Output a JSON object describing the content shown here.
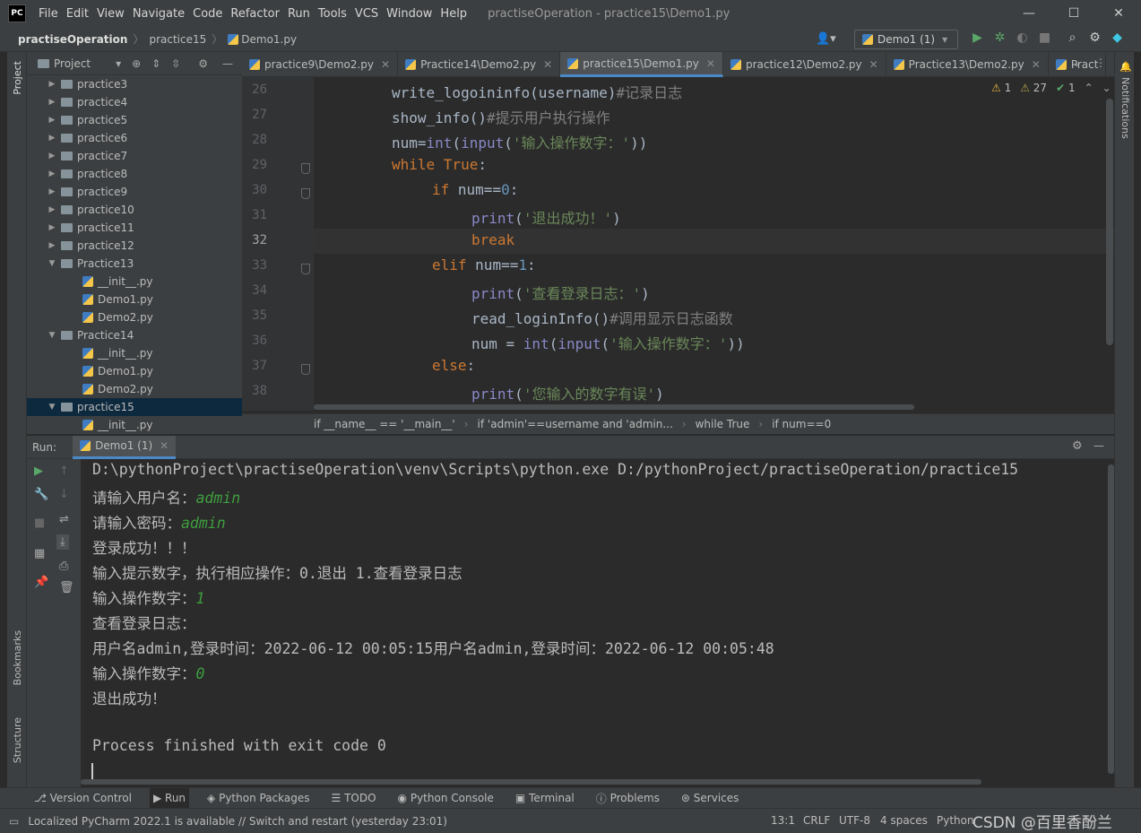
{
  "titlebar": {
    "logo": "PC",
    "menu": [
      "File",
      "Edit",
      "View",
      "Navigate",
      "Code",
      "Refactor",
      "Run",
      "Tools",
      "VCS",
      "Window",
      "Help"
    ],
    "window_title": "practiseOperation - practice15\\Demo1.py",
    "minimize": "—",
    "maximize": "☐",
    "close": "✕"
  },
  "navbar": {
    "project": "practiseOperation",
    "folder": "practice15",
    "file": "Demo1.py",
    "run_config": "Demo1 (1)"
  },
  "project_panel": {
    "title": "Project",
    "items": [
      {
        "label": "practice3",
        "type": "folder",
        "expanded": false,
        "indent": 1
      },
      {
        "label": "practice4",
        "type": "folder",
        "expanded": false,
        "indent": 1
      },
      {
        "label": "practice5",
        "type": "folder",
        "expanded": false,
        "indent": 1
      },
      {
        "label": "practice6",
        "type": "folder",
        "expanded": false,
        "indent": 1
      },
      {
        "label": "practice7",
        "type": "folder",
        "expanded": false,
        "indent": 1
      },
      {
        "label": "practice8",
        "type": "folder",
        "expanded": false,
        "indent": 1
      },
      {
        "label": "practice9",
        "type": "folder",
        "expanded": false,
        "indent": 1
      },
      {
        "label": "practice10",
        "type": "folder",
        "expanded": false,
        "indent": 1
      },
      {
        "label": "practice11",
        "type": "folder",
        "expanded": false,
        "indent": 1
      },
      {
        "label": "practice12",
        "type": "folder",
        "expanded": false,
        "indent": 1
      },
      {
        "label": "Practice13",
        "type": "folder",
        "expanded": true,
        "indent": 1
      },
      {
        "label": "__init__.py",
        "type": "py",
        "indent": 2
      },
      {
        "label": "Demo1.py",
        "type": "py",
        "indent": 2
      },
      {
        "label": "Demo2.py",
        "type": "py",
        "indent": 2
      },
      {
        "label": "Practice14",
        "type": "folder",
        "expanded": true,
        "indent": 1
      },
      {
        "label": "__init__.py",
        "type": "py",
        "indent": 2
      },
      {
        "label": "Demo1.py",
        "type": "py",
        "indent": 2
      },
      {
        "label": "Demo2.py",
        "type": "py",
        "indent": 2
      },
      {
        "label": "practice15",
        "type": "folder",
        "expanded": true,
        "indent": 1,
        "selected": true
      },
      {
        "label": "__init__.py",
        "type": "py",
        "indent": 2
      }
    ]
  },
  "tabs": [
    {
      "label": "practice9\\Demo2.py",
      "active": false
    },
    {
      "label": "Practice14\\Demo2.py",
      "active": false
    },
    {
      "label": "practice15\\Demo1.py",
      "active": true
    },
    {
      "label": "practice12\\Demo2.py",
      "active": false
    },
    {
      "label": "Practice13\\Demo2.py",
      "active": false
    },
    {
      "label": "Pract",
      "active": false
    }
  ],
  "inspections": {
    "warnings": "1",
    "weak_warnings": "27",
    "ok": "1"
  },
  "editor": {
    "line_numbers": [
      "26",
      "27",
      "28",
      "29",
      "30",
      "31",
      "32",
      "33",
      "34",
      "35",
      "36",
      "37",
      "38"
    ],
    "current_line": "32"
  },
  "breadcrumb": [
    "if __name__ == '__main__'",
    "if 'admin'==username and 'admin...",
    "while True",
    "if num==0"
  ],
  "run_panel": {
    "label": "Run:",
    "tab": "Demo1 (1)",
    "lines": [
      {
        "text": "D:\\pythonProject\\practiseOperation\\venv\\Scripts\\python.exe D:/pythonProject/practiseOperation/practice15",
        "input": ""
      },
      {
        "text": "请输入用户名：",
        "input": "admin"
      },
      {
        "text": "请输入密码：",
        "input": "admin"
      },
      {
        "text": "登录成功！！！",
        "input": ""
      },
      {
        "text": "输入提示数字，执行相应操作：0.退出 1.查看登录日志",
        "input": ""
      },
      {
        "text": "输入操作数字：",
        "input": "1"
      },
      {
        "text": "查看登录日志：",
        "input": ""
      },
      {
        "text": "用户名admin,登录时间：2022-06-12 00:05:15用户名admin,登录时间：2022-06-12 00:05:48",
        "input": ""
      },
      {
        "text": "输入操作数字：",
        "input": "0"
      },
      {
        "text": "退出成功！",
        "input": ""
      },
      {
        "text": "",
        "input": ""
      },
      {
        "text": "Process finished with exit code 0",
        "input": ""
      }
    ]
  },
  "bottom_tools": [
    "Version Control",
    "Run",
    "Python Packages",
    "TODO",
    "Python Console",
    "Terminal",
    "Problems",
    "Services"
  ],
  "statusbar": {
    "message": "Localized PyCharm 2022.1 is available // Switch and restart (yesterday 23:01)",
    "position": "13:1",
    "line_sep": "CRLF",
    "encoding": "UTF-8",
    "indent": "4 spaces",
    "interpreter": "Python",
    "watermark": "CSDN @百里香酚兰"
  },
  "side_labels": {
    "project": "Project",
    "bookmarks": "Bookmarks",
    "structure": "Structure",
    "notifications": "Notifications"
  }
}
